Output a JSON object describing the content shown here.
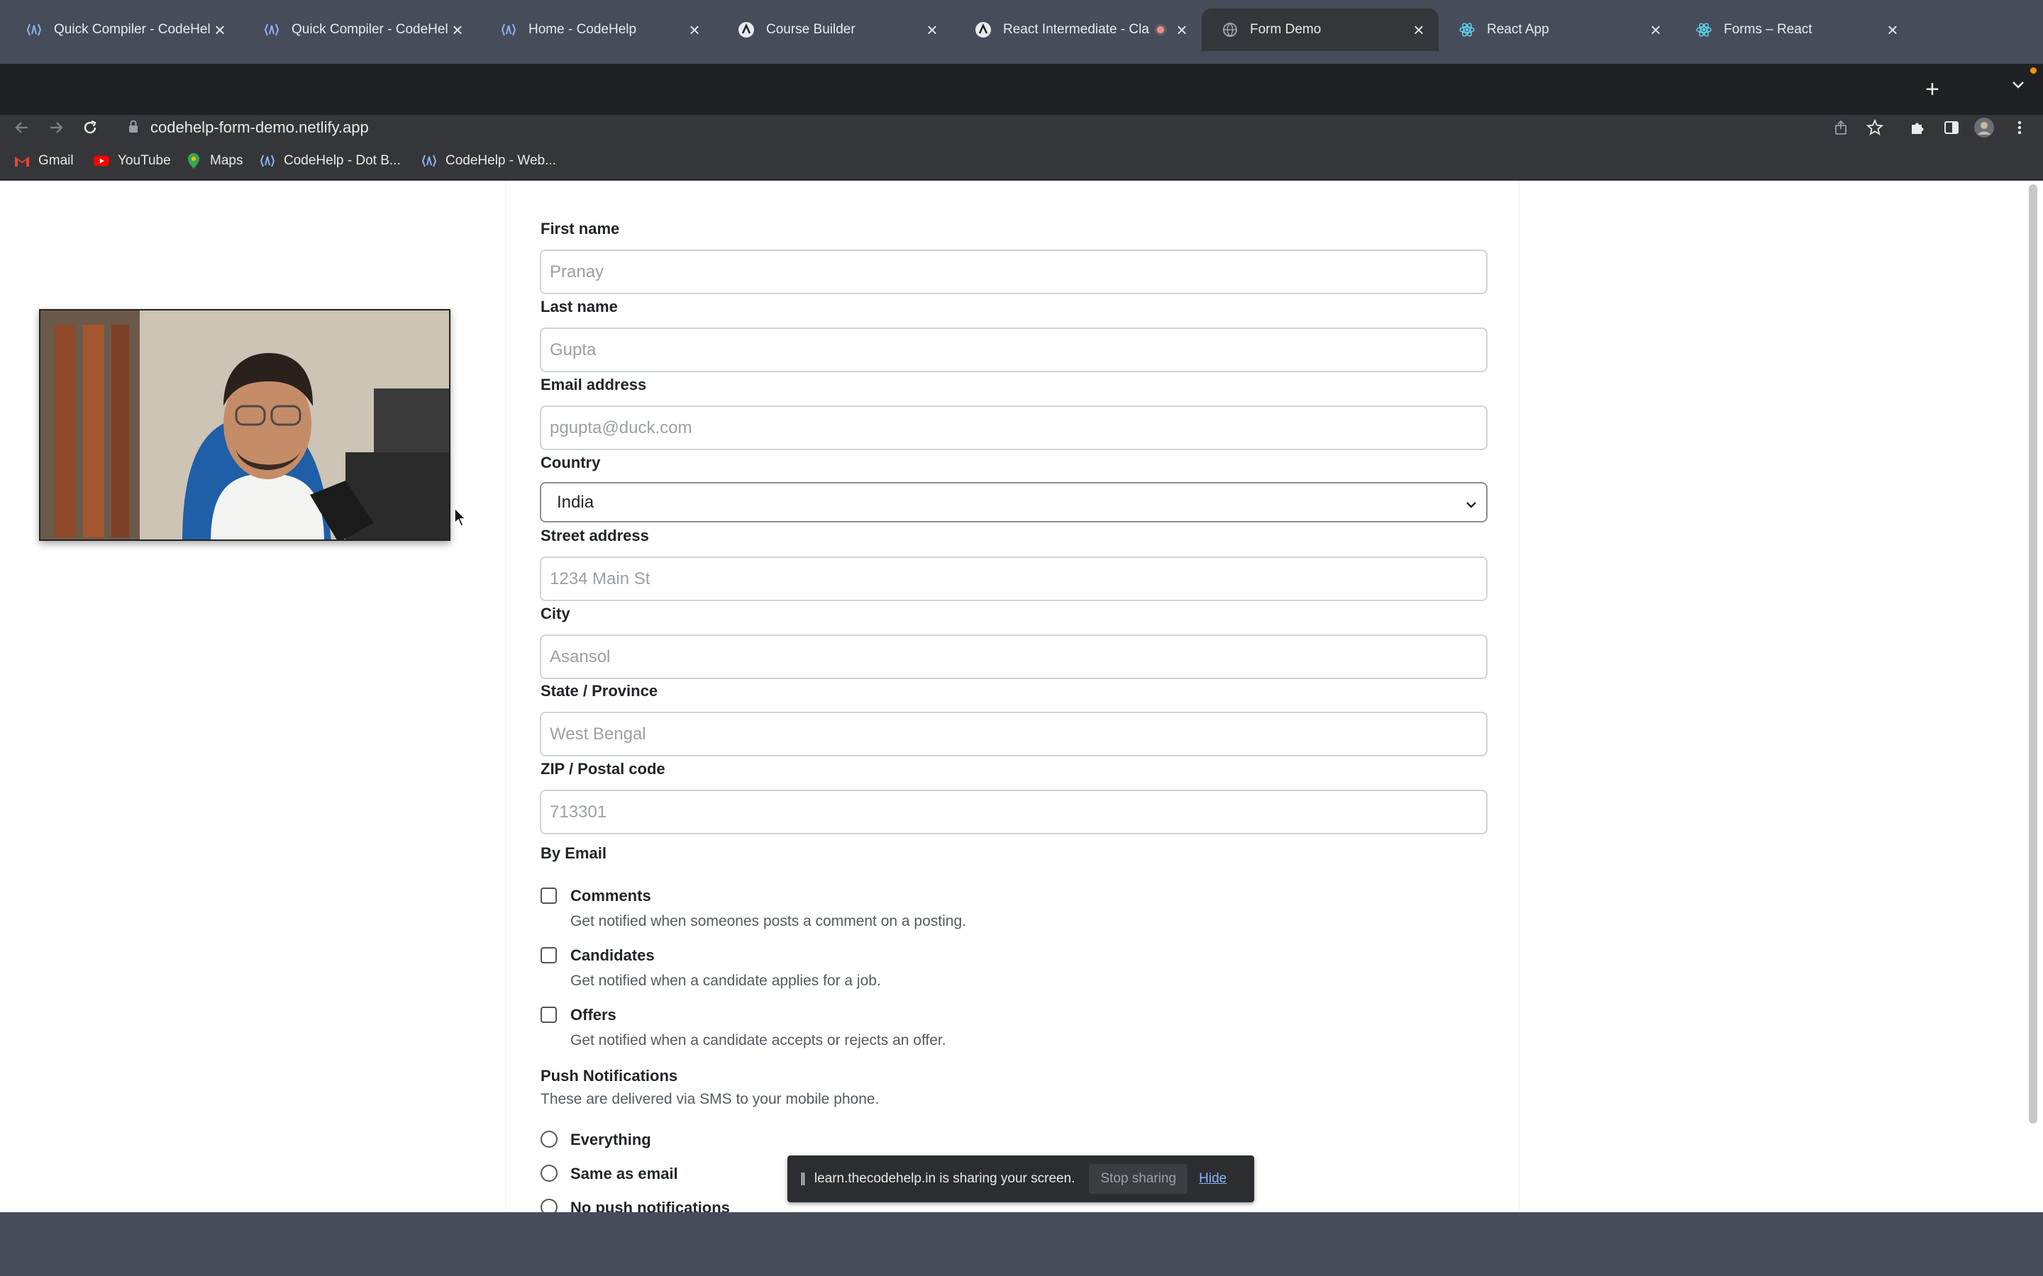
{
  "browser": {
    "tabs": [
      {
        "title": "Quick Compiler - CodeHelp",
        "favicon": "codehelp-logo-icon"
      },
      {
        "title": "Quick Compiler - CodeHelp",
        "favicon": "codehelp-logo-icon"
      },
      {
        "title": "Home - CodeHelp",
        "favicon": "codehelp-logo-icon"
      },
      {
        "title": "Course Builder",
        "favicon": "course-builder-icon"
      },
      {
        "title": "React Intermediate - Cla",
        "favicon": "course-builder-icon"
      },
      {
        "title": "Form Demo",
        "favicon": "globe-icon"
      },
      {
        "title": "React App",
        "favicon": "react-icon"
      },
      {
        "title": "Forms – React",
        "favicon": "react-icon"
      }
    ],
    "active_tab_index": 5,
    "url": "codehelp-form-demo.netlify.app",
    "bookmarks": [
      {
        "label": "Gmail",
        "icon": "gmail-icon"
      },
      {
        "label": "YouTube",
        "icon": "youtube-icon"
      },
      {
        "label": "Maps",
        "icon": "maps-icon"
      },
      {
        "label": "CodeHelp - Dot B...",
        "icon": "codehelp-logo-icon"
      },
      {
        "label": "CodeHelp - Web...",
        "icon": "codehelp-logo-icon"
      }
    ]
  },
  "form": {
    "first_name": {
      "label": "First name",
      "placeholder": "Pranay"
    },
    "last_name": {
      "label": "Last name",
      "placeholder": "Gupta"
    },
    "email": {
      "label": "Email address",
      "placeholder": "pgupta@duck.com"
    },
    "country": {
      "label": "Country",
      "value": "India"
    },
    "street": {
      "label": "Street address",
      "placeholder": "1234 Main St"
    },
    "city": {
      "label": "City",
      "placeholder": "Asansol"
    },
    "state": {
      "label": "State / Province",
      "placeholder": "West Bengal"
    },
    "zip": {
      "label": "ZIP / Postal code",
      "placeholder": "713301"
    },
    "by_email": {
      "title": "By Email",
      "options": [
        {
          "label": "Comments",
          "description": "Get notified when someones posts a comment on a posting.",
          "checked": false
        },
        {
          "label": "Candidates",
          "description": "Get notified when a candidate applies for a job.",
          "checked": false
        },
        {
          "label": "Offers",
          "description": "Get notified when a candidate accepts or rejects an offer.",
          "checked": false
        }
      ]
    },
    "push": {
      "title": "Push Notifications",
      "description": "These are delivered via SMS to your mobile phone.",
      "options": [
        {
          "label": "Everything",
          "selected": false
        },
        {
          "label": "Same as email",
          "selected": false
        },
        {
          "label": "No push notifications",
          "selected": false
        }
      ]
    }
  },
  "share_bar": {
    "message": "learn.thecodehelp.in is sharing your screen.",
    "stop_label": "Stop sharing",
    "hide_label": "Hide"
  }
}
